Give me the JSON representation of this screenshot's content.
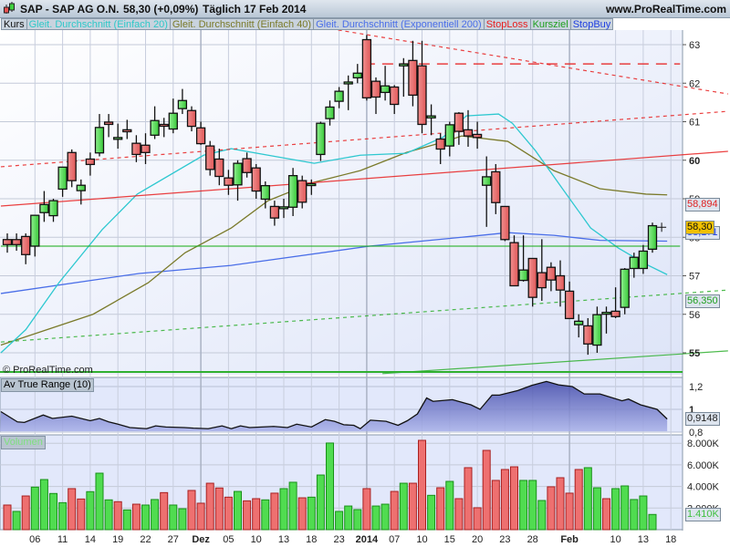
{
  "header": {
    "title": "SAP - SAP AG O.N.",
    "price": "58,30 (+0,09%)",
    "period": "Täglich  17 Feb 2014",
    "site": "www.ProRealTime.com"
  },
  "legend": [
    {
      "label": "Kurs",
      "color": "#111111"
    },
    {
      "label": "Gleit. Durchschnitt (Einfach 20)",
      "color": "#2ec8c8"
    },
    {
      "label": "Gleit. Durchschnitt (Einfach 40)",
      "color": "#7a7a2a"
    },
    {
      "label": "Gleit. Durchschnitt (Exponentiell 200)",
      "color": "#4a6ee8"
    },
    {
      "label": "StopLoss",
      "color": "#e82020"
    },
    {
      "label": "Kursziel",
      "color": "#20a020"
    },
    {
      "label": "StopBuy",
      "color": "#2040e0"
    }
  ],
  "copyright": "© ProRealTime.com",
  "price_labels": {
    "stoploss": "58,894",
    "last": "58,30",
    "ema200": "58,171",
    "kursziel": "56,350"
  },
  "atr_panel": {
    "name": "Av True Range (10)",
    "last": "0,9148",
    "ticks": [
      "1,2",
      "1",
      "0,8"
    ]
  },
  "volume_panel": {
    "name": "Volumen",
    "last": "1.410K",
    "ticks": [
      "8.000K",
      "6.000K",
      "4.000K",
      "2.000K"
    ]
  },
  "chart_data": {
    "type": "candlestick",
    "price_axis": {
      "min": 54.5,
      "max": 63.4,
      "ticks": [
        "63",
        "62",
        "61",
        "60",
        "59",
        "58",
        "57",
        "56",
        "55"
      ],
      "tick_values": [
        63,
        62,
        61,
        60,
        59,
        58,
        57,
        56,
        55
      ]
    },
    "x_labels": [
      {
        "label": "06",
        "bar": 3,
        "bold": false
      },
      {
        "label": "11",
        "bar": 6,
        "bold": false
      },
      {
        "label": "14",
        "bar": 9,
        "bold": false
      },
      {
        "label": "19",
        "bar": 12,
        "bold": false
      },
      {
        "label": "22",
        "bar": 15,
        "bold": false
      },
      {
        "label": "27",
        "bar": 18,
        "bold": false
      },
      {
        "label": "Dez",
        "bar": 21,
        "bold": true
      },
      {
        "label": "05",
        "bar": 24,
        "bold": false
      },
      {
        "label": "10",
        "bar": 27,
        "bold": false
      },
      {
        "label": "13",
        "bar": 30,
        "bold": false
      },
      {
        "label": "18",
        "bar": 33,
        "bold": false
      },
      {
        "label": "23",
        "bar": 36,
        "bold": false
      },
      {
        "label": "2014",
        "bar": 39,
        "bold": true
      },
      {
        "label": "07",
        "bar": 42,
        "bold": false
      },
      {
        "label": "10",
        "bar": 45,
        "bold": false
      },
      {
        "label": "15",
        "bar": 48,
        "bold": false
      },
      {
        "label": "20",
        "bar": 51,
        "bold": false
      },
      {
        "label": "23",
        "bar": 54,
        "bold": false
      },
      {
        "label": "28",
        "bar": 57,
        "bold": false
      },
      {
        "label": "Feb",
        "bar": 61,
        "bold": true
      },
      {
        "label": "10",
        "bar": 66,
        "bold": false
      },
      {
        "label": "13",
        "bar": 69,
        "bold": false
      },
      {
        "label": "18",
        "bar": 72,
        "bold": false
      }
    ],
    "ohlc": [
      [
        57.94,
        58.1,
        57.6,
        57.81
      ],
      [
        57.94,
        58.1,
        57.65,
        57.81
      ],
      [
        58.02,
        58.1,
        57.3,
        57.55
      ],
      [
        57.77,
        58.57,
        57.5,
        58.57
      ],
      [
        58.64,
        59.2,
        58.4,
        58.85
      ],
      [
        58.56,
        59.0,
        58.4,
        58.95
      ],
      [
        59.25,
        59.82,
        59.05,
        59.82
      ],
      [
        60.2,
        60.28,
        59.3,
        59.47
      ],
      [
        59.21,
        59.5,
        58.85,
        59.35
      ],
      [
        60.03,
        60.2,
        59.6,
        59.89
      ],
      [
        60.19,
        61.2,
        60.1,
        60.85
      ],
      [
        60.99,
        61.2,
        60.6,
        60.93
      ],
      [
        60.59,
        60.95,
        60.3,
        60.59
      ],
      [
        60.79,
        61.05,
        60.55,
        60.74
      ],
      [
        60.44,
        60.65,
        59.95,
        60.15
      ],
      [
        60.39,
        60.7,
        59.9,
        60.2
      ],
      [
        60.65,
        61.4,
        60.55,
        61.03
      ],
      [
        60.93,
        61.1,
        60.6,
        60.89
      ],
      [
        60.81,
        61.6,
        60.7,
        61.22
      ],
      [
        61.34,
        61.85,
        61.2,
        61.55
      ],
      [
        61.29,
        61.4,
        60.75,
        60.88
      ],
      [
        60.84,
        61.0,
        60.4,
        60.43
      ],
      [
        60.37,
        60.5,
        59.6,
        59.76
      ],
      [
        60.03,
        60.3,
        59.35,
        59.58
      ],
      [
        59.54,
        59.75,
        59.1,
        59.35
      ],
      [
        59.36,
        60.0,
        58.95,
        59.92
      ],
      [
        60.04,
        60.2,
        59.55,
        59.68
      ],
      [
        59.8,
        59.9,
        59.0,
        59.2
      ],
      [
        58.99,
        59.45,
        58.75,
        59.34
      ],
      [
        58.8,
        58.95,
        58.3,
        58.5
      ],
      [
        58.76,
        59.0,
        58.5,
        58.79
      ],
      [
        58.78,
        59.8,
        58.55,
        59.6
      ],
      [
        59.47,
        59.6,
        58.75,
        58.91
      ],
      [
        59.35,
        59.5,
        59.1,
        59.39
      ],
      [
        60.15,
        61.0,
        59.98,
        60.96
      ],
      [
        61.08,
        61.55,
        60.9,
        61.38
      ],
      [
        61.53,
        61.9,
        61.35,
        61.79
      ],
      [
        62.03,
        62.2,
        61.3,
        62.03
      ],
      [
        62.14,
        62.5,
        62.0,
        62.26
      ],
      [
        63.13,
        63.25,
        61.55,
        61.62
      ],
      [
        62.05,
        62.15,
        61.2,
        61.64
      ],
      [
        61.76,
        62.45,
        61.55,
        61.93
      ],
      [
        61.9,
        61.95,
        61.2,
        61.45
      ],
      [
        62.45,
        62.65,
        61.65,
        62.5
      ],
      [
        62.59,
        63.1,
        61.4,
        61.69
      ],
      [
        62.45,
        63.1,
        60.7,
        60.93
      ],
      [
        61.1,
        61.45,
        60.65,
        61.15
      ],
      [
        60.55,
        60.7,
        59.9,
        60.29
      ],
      [
        60.37,
        61.0,
        60.1,
        60.92
      ],
      [
        61.22,
        61.25,
        60.4,
        60.75
      ],
      [
        60.79,
        61.3,
        60.35,
        60.63
      ],
      [
        60.67,
        61.0,
        60.3,
        60.59
      ],
      [
        59.35,
        60.1,
        58.27,
        59.57
      ],
      [
        59.7,
        59.9,
        58.6,
        58.9
      ],
      [
        58.8,
        58.8,
        57.9,
        57.94
      ],
      [
        57.86,
        58.05,
        56.9,
        56.74
      ],
      [
        56.88,
        58.05,
        56.85,
        57.15
      ],
      [
        57.45,
        57.45,
        56.2,
        56.44
      ],
      [
        57.08,
        57.95,
        56.35,
        56.69
      ],
      [
        57.22,
        57.35,
        56.6,
        56.89
      ],
      [
        57.0,
        57.4,
        56.2,
        56.63
      ],
      [
        56.6,
        56.85,
        56.2,
        55.89
      ],
      [
        55.73,
        56.0,
        55.4,
        55.82
      ],
      [
        55.7,
        55.9,
        54.95,
        55.23
      ],
      [
        55.2,
        56.2,
        55.0,
        55.99
      ],
      [
        56.05,
        56.2,
        55.5,
        56.05
      ],
      [
        56.08,
        56.7,
        55.9,
        55.94
      ],
      [
        56.18,
        57.2,
        56.0,
        57.17
      ],
      [
        57.19,
        57.6,
        56.95,
        57.48
      ],
      [
        57.19,
        57.8,
        57.05,
        57.64
      ],
      [
        57.69,
        58.38,
        57.6,
        58.3
      ]
    ],
    "current_marker": {
      "bar": 71,
      "price": 58.26
    },
    "ma20": [
      [
        -0.7,
        55.0
      ],
      [
        2,
        55.6
      ],
      [
        5.6,
        56.82
      ],
      [
        10.3,
        58.2
      ],
      [
        14.1,
        59.12
      ],
      [
        21.3,
        60.13
      ],
      [
        24.3,
        60.3
      ],
      [
        28.3,
        60.13
      ],
      [
        33.3,
        59.92
      ],
      [
        38.3,
        60.13
      ],
      [
        43.3,
        60.18
      ],
      [
        47.3,
        60.6
      ],
      [
        49.8,
        61.15
      ],
      [
        53.3,
        61.2
      ],
      [
        54.8,
        60.96
      ],
      [
        57.3,
        60.25
      ],
      [
        60.3,
        59.24
      ],
      [
        63.3,
        58.24
      ],
      [
        66.3,
        57.72
      ],
      [
        69.3,
        57.3
      ],
      [
        71.6,
        57.03
      ]
    ],
    "ma40": [
      [
        -0.7,
        55.2
      ],
      [
        9.3,
        56.0
      ],
      [
        15.3,
        56.82
      ],
      [
        19.3,
        57.6
      ],
      [
        24.3,
        58.24
      ],
      [
        28.3,
        58.95
      ],
      [
        33.3,
        59.43
      ],
      [
        38.3,
        59.73
      ],
      [
        43.3,
        60.2
      ],
      [
        47.3,
        60.47
      ],
      [
        49.3,
        60.63
      ],
      [
        54.3,
        60.49
      ],
      [
        59.3,
        59.73
      ],
      [
        64.3,
        59.26
      ],
      [
        69.3,
        59.12
      ],
      [
        71.6,
        59.1
      ]
    ],
    "ema200": [
      [
        -0.7,
        56.54
      ],
      [
        14.3,
        57.06
      ],
      [
        24.3,
        57.27
      ],
      [
        39.3,
        57.77
      ],
      [
        49.3,
        58.0
      ],
      [
        54.3,
        58.12
      ],
      [
        59.3,
        58.05
      ],
      [
        64.3,
        57.92
      ],
      [
        71.6,
        57.9
      ]
    ],
    "atr": [
      [
        -0.7,
        0.98
      ],
      [
        1.1,
        0.89
      ],
      [
        1.85,
        0.885
      ],
      [
        3.9,
        0.95
      ],
      [
        4.9,
        0.92
      ],
      [
        7,
        0.94
      ],
      [
        9,
        0.9
      ],
      [
        10,
        0.92
      ],
      [
        11,
        0.89
      ],
      [
        12,
        0.87
      ],
      [
        13.3,
        0.84
      ],
      [
        15.1,
        0.83
      ],
      [
        16.1,
        0.855
      ],
      [
        17.2,
        0.845
      ],
      [
        19.2,
        0.84
      ],
      [
        20.2,
        0.835
      ],
      [
        21.8,
        0.83
      ],
      [
        23.3,
        0.855
      ],
      [
        24.3,
        0.83
      ],
      [
        25.3,
        0.855
      ],
      [
        26.3,
        0.84
      ],
      [
        28.9,
        0.85
      ],
      [
        30.4,
        0.84
      ],
      [
        31.4,
        0.87
      ],
      [
        33,
        0.845
      ],
      [
        34.5,
        0.91
      ],
      [
        35.5,
        0.895
      ],
      [
        36.5,
        0.865
      ],
      [
        37.6,
        0.86
      ],
      [
        38.3,
        0.83
      ],
      [
        39.4,
        0.905
      ],
      [
        41.1,
        0.895
      ],
      [
        42.4,
        0.86
      ],
      [
        43.4,
        0.9
      ],
      [
        44.5,
        0.96
      ],
      [
        45.5,
        1.1
      ],
      [
        46.2,
        1.07
      ],
      [
        48.3,
        1.085
      ],
      [
        50.3,
        1.04
      ],
      [
        51.3,
        1.0
      ],
      [
        52.6,
        1.125
      ],
      [
        53.4,
        1.125
      ],
      [
        54.4,
        1.145
      ],
      [
        55.4,
        1.165
      ],
      [
        56.9,
        1.21
      ],
      [
        58.5,
        1.245
      ],
      [
        59.8,
        1.215
      ],
      [
        61.3,
        1.2
      ],
      [
        62.6,
        1.135
      ],
      [
        64.3,
        1.135
      ],
      [
        66.7,
        1.075
      ],
      [
        67.4,
        1.09
      ],
      [
        68.7,
        1.04
      ],
      [
        70.5,
        1.0
      ],
      [
        71.6,
        0.9148
      ]
    ],
    "volume_k": [
      2280,
      1690,
      3120,
      3940,
      4640,
      3350,
      2500,
      3800,
      2840,
      3520,
      5230,
      2760,
      2590,
      1830,
      2360,
      2280,
      2790,
      3430,
      2280,
      1940,
      3630,
      2450,
      4300,
      3860,
      3010,
      3540,
      2670,
      2870,
      2760,
      3380,
      3800,
      4390,
      2950,
      3010,
      5060,
      8020,
      1690,
      2190,
      1860,
      3800,
      2190,
      2360,
      3540,
      4300,
      4300,
      8270,
      3180,
      3880,
      4470,
      2870,
      5740,
      2030,
      7340,
      4560,
      5570,
      5820,
      4560,
      4560,
      2700,
      3970,
      4810,
      3380,
      5570,
      5740,
      3880,
      2870,
      3800,
      4050,
      2790,
      3120,
      1410
    ],
    "volume_up": [
      0,
      1,
      0,
      1,
      1,
      1,
      1,
      0,
      0,
      1,
      1,
      1,
      0,
      1,
      0,
      1,
      1,
      0,
      1,
      1,
      0,
      0,
      0,
      0,
      0,
      1,
      0,
      0,
      1,
      0,
      1,
      1,
      0,
      1,
      1,
      1,
      1,
      1,
      1,
      0,
      1,
      1,
      0,
      1,
      0,
      0,
      1,
      0,
      1,
      0,
      0,
      0,
      0,
      0,
      0,
      0,
      1,
      1,
      1,
      0,
      0,
      0,
      0,
      1,
      1,
      0,
      1,
      1,
      1,
      1,
      1
    ],
    "lines": {
      "stoploss_trend": {
        "from": [
          -0.7,
          58.81
        ],
        "to": [
          78.2,
          60.23
        ],
        "color": "#e82020",
        "dash": false
      },
      "upper_dashed": {
        "from": [
          -0.7,
          59.83
        ],
        "to": [
          78.2,
          61.27
        ],
        "color": "#e82020",
        "dash": true
      },
      "resistance_dashed": {
        "from": [
          35.9,
          63.38
        ],
        "to": [
          78.2,
          61.72
        ],
        "color": "#e82020",
        "dash": true
      },
      "stop_level": {
        "from": [
          38.7,
          62.5
        ],
        "to": [
          73.0,
          62.5
        ],
        "color": "#e82020",
        "dash": "long"
      },
      "kursziel_h": {
        "from": [
          -0.7,
          57.77
        ],
        "to": [
          73.0,
          57.77
        ],
        "color": "#20b020",
        "dash": false
      },
      "lower_dashed": {
        "from": [
          -0.7,
          55.28
        ],
        "to": [
          78.2,
          56.63
        ],
        "color": "#30b030",
        "dash": true
      },
      "support": {
        "from": [
          40.7,
          54.46
        ],
        "to": [
          78.2,
          55.05
        ],
        "color": "#30b030",
        "dash": false
      }
    }
  }
}
